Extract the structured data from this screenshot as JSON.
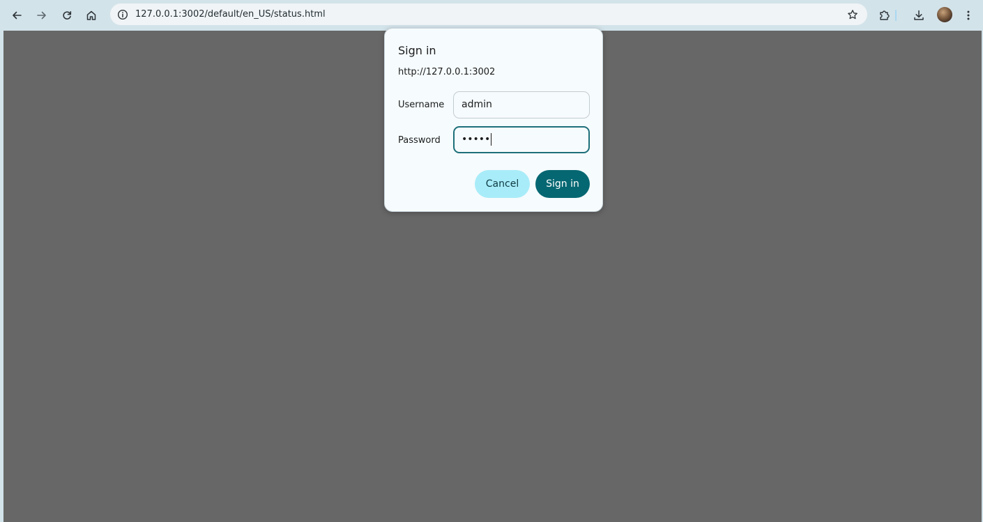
{
  "browser": {
    "url": "127.0.0.1:3002/default/en_US/status.html",
    "icons": {
      "back": "arrow-left-icon",
      "forward": "arrow-right-icon",
      "reload": "reload-icon",
      "home": "home-icon",
      "site_info": "info-icon",
      "bookmark": "star-icon",
      "extensions": "puzzle-icon",
      "downloads": "download-icon",
      "profile": "avatar",
      "menu": "kebab-menu-icon"
    }
  },
  "dialog": {
    "title": "Sign in",
    "origin": "http://127.0.0.1:3002",
    "username_label": "Username",
    "username_value": "admin",
    "password_label": "Password",
    "password_masked": "•••••",
    "cancel_label": "Cancel",
    "signin_label": "Sign in"
  },
  "colors": {
    "toolbar_bg": "#d3e3ea",
    "page_bg": "#676767",
    "dialog_bg": "#f6fbfd",
    "accent": "#056772",
    "cancel_bg": "#a8ecf9",
    "focus_border": "#1d6f7a"
  }
}
